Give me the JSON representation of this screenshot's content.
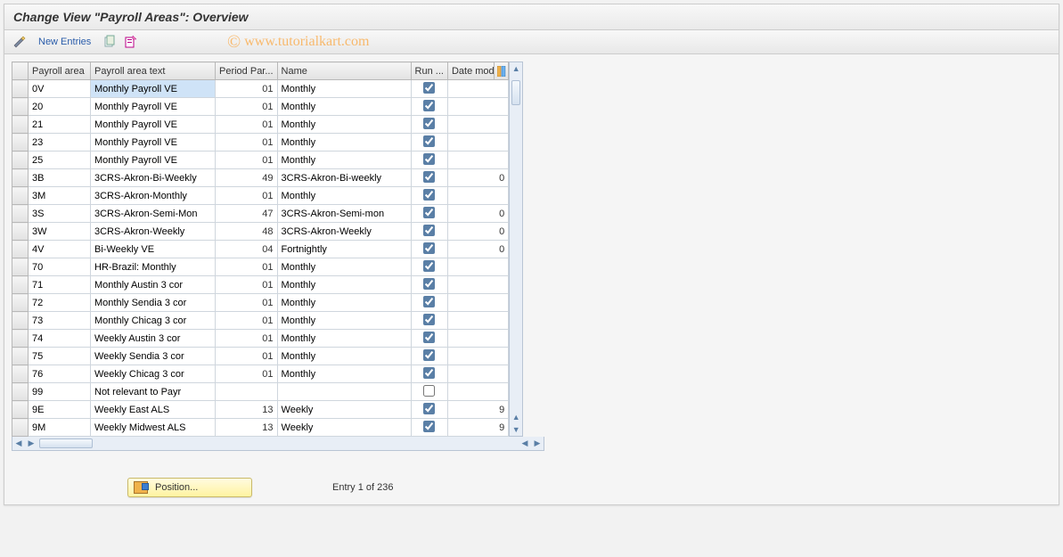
{
  "title": "Change View \"Payroll Areas\": Overview",
  "toolbar": {
    "new_entries": "New Entries"
  },
  "watermark": "www.tutorialkart.com",
  "columns": {
    "sel": "",
    "area": "Payroll area",
    "text": "Payroll area text",
    "per": "Period Par...",
    "name": "Name",
    "run": "Run ...",
    "date": "Date modi..."
  },
  "rows": [
    {
      "area": "0V",
      "text": "Monthly Payroll  VE",
      "per": "01",
      "name": "Monthly",
      "run": true,
      "date": "",
      "hl": true
    },
    {
      "area": "20",
      "text": "Monthly Payroll  VE",
      "per": "01",
      "name": "Monthly",
      "run": true,
      "date": ""
    },
    {
      "area": "21",
      "text": "Monthly Payroll  VE",
      "per": "01",
      "name": "Monthly",
      "run": true,
      "date": ""
    },
    {
      "area": "23",
      "text": "Monthly Payroll  VE",
      "per": "01",
      "name": "Monthly",
      "run": true,
      "date": ""
    },
    {
      "area": "25",
      "text": "Monthly Payroll  VE",
      "per": "01",
      "name": "Monthly",
      "run": true,
      "date": ""
    },
    {
      "area": "3B",
      "text": "3CRS-Akron-Bi-Weekly",
      "per": "49",
      "name": "3CRS-Akron-Bi-weekly",
      "run": true,
      "date": "0"
    },
    {
      "area": "3M",
      "text": "3CRS-Akron-Monthly",
      "per": "01",
      "name": "Monthly",
      "run": true,
      "date": ""
    },
    {
      "area": "3S",
      "text": "3CRS-Akron-Semi-Mon",
      "per": "47",
      "name": "3CRS-Akron-Semi-mon",
      "run": true,
      "date": "0"
    },
    {
      "area": "3W",
      "text": "3CRS-Akron-Weekly",
      "per": "48",
      "name": "3CRS-Akron-Weekly",
      "run": true,
      "date": "0"
    },
    {
      "area": "4V",
      "text": "Bi-Weekly VE",
      "per": "04",
      "name": "Fortnightly",
      "run": true,
      "date": "0"
    },
    {
      "area": "70",
      "text": "HR-Brazil: Monthly",
      "per": "01",
      "name": "Monthly",
      "run": true,
      "date": ""
    },
    {
      "area": "71",
      "text": "Monthly Austin 3 cor",
      "per": "01",
      "name": "Monthly",
      "run": true,
      "date": ""
    },
    {
      "area": "72",
      "text": "Monthly Sendia 3 cor",
      "per": "01",
      "name": "Monthly",
      "run": true,
      "date": ""
    },
    {
      "area": "73",
      "text": "Monthly Chicag 3 cor",
      "per": "01",
      "name": "Monthly",
      "run": true,
      "date": ""
    },
    {
      "area": "74",
      "text": "Weekly Austin 3 cor",
      "per": "01",
      "name": "Monthly",
      "run": true,
      "date": ""
    },
    {
      "area": "75",
      "text": "Weekly Sendia 3 cor",
      "per": "01",
      "name": "Monthly",
      "run": true,
      "date": ""
    },
    {
      "area": "76",
      "text": "Weekly Chicag 3 cor",
      "per": "01",
      "name": "Monthly",
      "run": true,
      "date": ""
    },
    {
      "area": "99",
      "text": "Not relevant to Payr",
      "per": "",
      "name": "",
      "run": false,
      "date": ""
    },
    {
      "area": "9E",
      "text": "Weekly East ALS",
      "per": "13",
      "name": "Weekly",
      "run": true,
      "date": "9"
    },
    {
      "area": "9M",
      "text": "Weekly Midwest ALS",
      "per": "13",
      "name": "Weekly",
      "run": true,
      "date": "9"
    }
  ],
  "footer": {
    "position": "Position...",
    "entry": "Entry 1 of 236"
  }
}
